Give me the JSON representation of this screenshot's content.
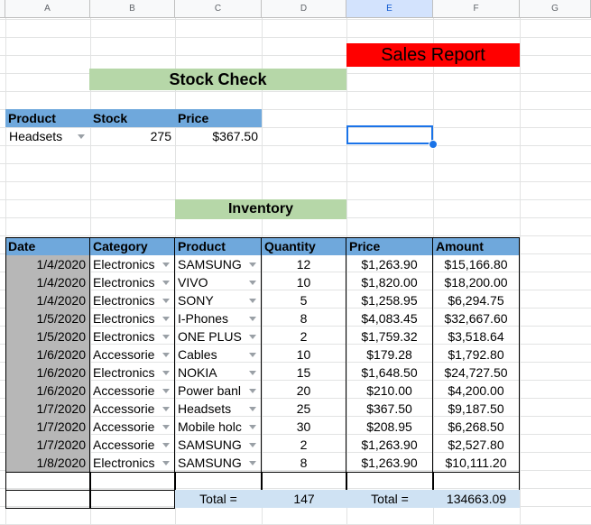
{
  "columns": [
    "A",
    "B",
    "C",
    "D",
    "E",
    "F",
    "G"
  ],
  "sales_title": "Sales Report",
  "stock_title": "Stock Check",
  "stock_headers": [
    "Product",
    "Stock",
    "Price"
  ],
  "stock_row": {
    "product": "Headsets",
    "stock": "275",
    "price": "$367.50"
  },
  "inventory_title": "Inventory",
  "inv_headers": [
    "Date",
    "Category",
    "Product",
    "Quantity",
    "Price",
    "Amount"
  ],
  "rows": [
    [
      "1/4/2020",
      "Electronics",
      "SAMSUNG",
      "12",
      "$1,263.90",
      "$15,166.80"
    ],
    [
      "1/4/2020",
      "Electronics",
      "VIVO",
      "10",
      "$1,820.00",
      "$18,200.00"
    ],
    [
      "1/4/2020",
      "Electronics",
      "SONY",
      "5",
      "$1,258.95",
      "$6,294.75"
    ],
    [
      "1/5/2020",
      "Electronics",
      "I-Phones",
      "8",
      "$4,083.45",
      "$32,667.60"
    ],
    [
      "1/5/2020",
      "Electronics",
      "ONE PLUS",
      "2",
      "$1,759.32",
      "$3,518.64"
    ],
    [
      "1/6/2020",
      "Accessorie",
      "Cables",
      "10",
      "$179.28",
      "$1,792.80"
    ],
    [
      "1/6/2020",
      "Electronics",
      "NOKIA",
      "15",
      "$1,648.50",
      "$24,727.50"
    ],
    [
      "1/6/2020",
      "Accessorie",
      "Power banl",
      "20",
      "$210.00",
      "$4,200.00"
    ],
    [
      "1/7/2020",
      "Accessorie",
      "Headsets",
      "25",
      "$367.50",
      "$9,187.50"
    ],
    [
      "1/7/2020",
      "Accessorie",
      "Mobile holc",
      "30",
      "$208.95",
      "$6,268.50"
    ],
    [
      "1/7/2020",
      "Accessorie",
      "SAMSUNG",
      "2",
      "$1,263.90",
      "$2,527.80"
    ],
    [
      "1/8/2020",
      "Electronics",
      "SAMSUNG",
      "8",
      "$1,263.90",
      "$10,111.20"
    ]
  ],
  "totals": {
    "qty_label": "Total =",
    "qty_value": "147",
    "amt_label": "Total =",
    "amt_value": "134663.09"
  },
  "colors": {
    "sales_bg": "#ff0000",
    "title_green": "#b6d7a8",
    "header_blue": "#6fa8dc",
    "total_blue": "#cfe2f3",
    "selection": "#1a73e8"
  }
}
